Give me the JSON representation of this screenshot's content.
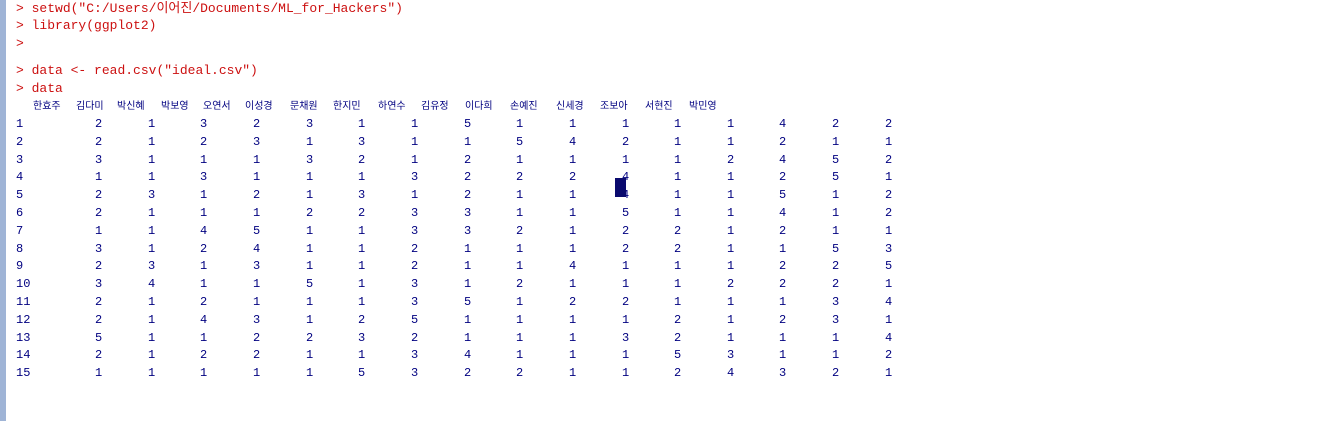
{
  "console": {
    "prompt": ">",
    "lines": [
      "setwd(\"C:/Users/이어진/Documents/ML_for_Hackers\")",
      "library(ggplot2)",
      "",
      "data <- read.csv(\"ideal.csv\")",
      "data"
    ]
  },
  "table": {
    "columns": [
      "한효주",
      "김다미",
      "박신혜",
      "박보영",
      "오연서",
      "이성경",
      "문채원",
      "한지민",
      "하연수",
      "김유정",
      "이다희",
      "손예진",
      "신세경",
      "조보아",
      "서현진",
      "박민영"
    ],
    "rows": [
      {
        "name": "1",
        "values": [
          "2",
          "1",
          "3",
          "2",
          "3",
          "1",
          "1",
          "5",
          "1",
          "1",
          "1",
          "1",
          "1",
          "4",
          "2",
          "2"
        ]
      },
      {
        "name": "2",
        "values": [
          "2",
          "1",
          "2",
          "3",
          "1",
          "3",
          "1",
          "1",
          "5",
          "4",
          "2",
          "1",
          "1",
          "2",
          "1",
          "1"
        ]
      },
      {
        "name": "3",
        "values": [
          "3",
          "1",
          "1",
          "1",
          "3",
          "2",
          "1",
          "2",
          "1",
          "1",
          "1",
          "1",
          "2",
          "4",
          "5",
          "2"
        ]
      },
      {
        "name": "4",
        "values": [
          "1",
          "1",
          "3",
          "1",
          "1",
          "1",
          "3",
          "2",
          "2",
          "2",
          "4",
          "1",
          "1",
          "2",
          "5",
          "1"
        ]
      },
      {
        "name": "5",
        "values": [
          "2",
          "3",
          "1",
          "2",
          "1",
          "3",
          "1",
          "2",
          "1",
          "1",
          "4",
          "1",
          "1",
          "5",
          "1",
          "2"
        ]
      },
      {
        "name": "6",
        "values": [
          "2",
          "1",
          "1",
          "1",
          "2",
          "2",
          "3",
          "3",
          "1",
          "1",
          "5",
          "1",
          "1",
          "4",
          "1",
          "2"
        ]
      },
      {
        "name": "7",
        "values": [
          "1",
          "1",
          "4",
          "5",
          "1",
          "1",
          "3",
          "3",
          "2",
          "1",
          "2",
          "2",
          "1",
          "2",
          "1",
          "1"
        ]
      },
      {
        "name": "8",
        "values": [
          "3",
          "1",
          "2",
          "4",
          "1",
          "1",
          "2",
          "1",
          "1",
          "1",
          "2",
          "2",
          "1",
          "1",
          "5",
          "3"
        ]
      },
      {
        "name": "9",
        "values": [
          "2",
          "3",
          "1",
          "3",
          "1",
          "1",
          "2",
          "1",
          "1",
          "4",
          "1",
          "1",
          "1",
          "2",
          "2",
          "5"
        ]
      },
      {
        "name": "10",
        "values": [
          "3",
          "4",
          "1",
          "1",
          "5",
          "1",
          "3",
          "1",
          "2",
          "1",
          "1",
          "1",
          "2",
          "2",
          "2",
          "1"
        ]
      },
      {
        "name": "11",
        "values": [
          "2",
          "1",
          "2",
          "1",
          "1",
          "1",
          "3",
          "5",
          "1",
          "2",
          "2",
          "1",
          "1",
          "1",
          "3",
          "4"
        ]
      },
      {
        "name": "12",
        "values": [
          "2",
          "1",
          "4",
          "3",
          "1",
          "2",
          "5",
          "1",
          "1",
          "1",
          "1",
          "2",
          "1",
          "2",
          "3",
          "1"
        ]
      },
      {
        "name": "13",
        "values": [
          "5",
          "1",
          "1",
          "2",
          "2",
          "3",
          "2",
          "1",
          "1",
          "1",
          "3",
          "2",
          "1",
          "1",
          "1",
          "4"
        ]
      },
      {
        "name": "14",
        "values": [
          "2",
          "1",
          "2",
          "2",
          "1",
          "1",
          "3",
          "4",
          "1",
          "1",
          "1",
          "5",
          "3",
          "1",
          "1",
          "2"
        ]
      },
      {
        "name": "15",
        "values": [
          "1",
          "1",
          "1",
          "1",
          "1",
          "5",
          "3",
          "2",
          "2",
          "1",
          "1",
          "2",
          "4",
          "3",
          "2",
          "1"
        ]
      }
    ]
  },
  "colors": {
    "prompt_text": "#cc1010",
    "output_text": "#000080",
    "cursor": "#0a0a6e",
    "border": "#9fb4d6"
  }
}
